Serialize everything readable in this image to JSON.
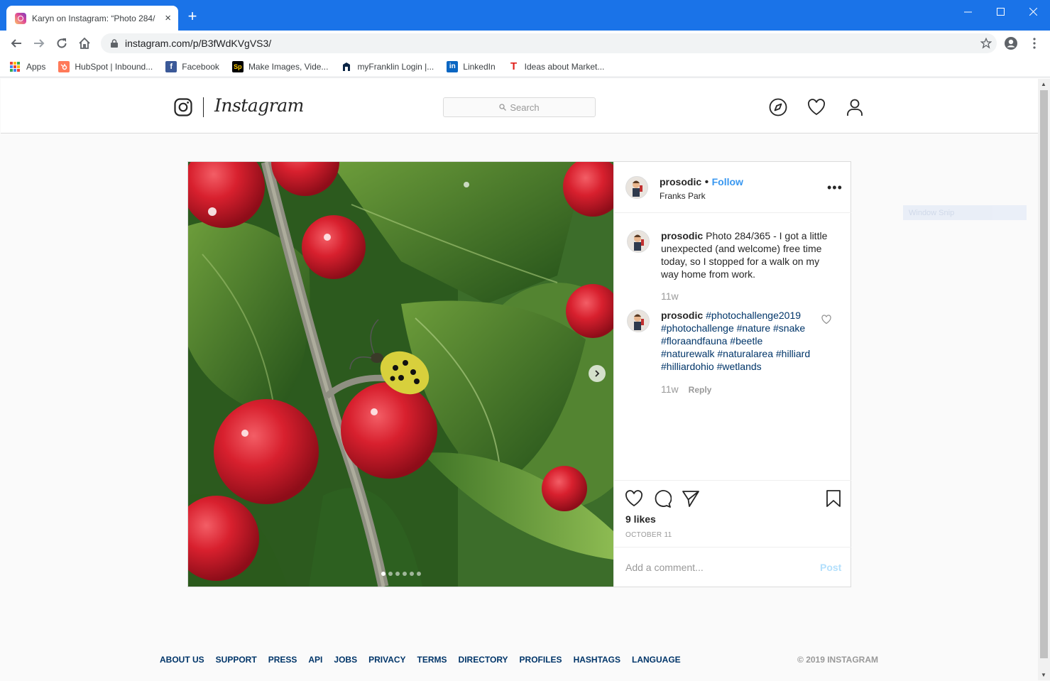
{
  "browser": {
    "tab_title": "Karyn on Instagram: “Photo 284/",
    "tab_close": "×",
    "new_tab": "+",
    "url": "instagram.com/p/B3fWdKVgVS3/",
    "bookmarks": [
      {
        "label": "Apps",
        "icon": "apps-grid-icon"
      },
      {
        "label": "HubSpot | Inbound...",
        "icon": "hubspot-icon",
        "color": "#ff7a59"
      },
      {
        "label": "Facebook",
        "icon": "facebook-icon",
        "color": "#3b5998",
        "glyph": "f"
      },
      {
        "label": "Make Images, Vide...",
        "icon": "spark-icon",
        "color": "#000000",
        "glyph": "Sp"
      },
      {
        "label": "myFranklin Login |...",
        "icon": "franklin-icon",
        "color": "#0b2545"
      },
      {
        "label": "LinkedIn",
        "icon": "linkedin-icon",
        "color": "#0a66c2",
        "glyph": "in"
      },
      {
        "label": "Ideas about Market...",
        "icon": "t-icon",
        "color": "#e0201b",
        "glyph": "T"
      }
    ]
  },
  "instagram": {
    "wordmark": "Instagram",
    "search_placeholder": "Search",
    "post": {
      "username": "prosodic",
      "separator": " • ",
      "follow": "Follow",
      "location": "Franks Park",
      "more": "•••",
      "caption_user": "prosodic",
      "caption": "Photo 284/365 - I got a little unexpected (and welcome) free time today, so I stopped for a walk on my way home from work.",
      "caption_age": "11w",
      "hashtag_comment": {
        "user": "prosodic",
        "tags": "#photochallenge2019 #photochallenge #nature #snake #floraandfauna #beetle #naturewalk #naturalarea #hilliard #hilliardohio #wetlands",
        "age": "11w",
        "reply": "Reply"
      },
      "likes": "9 likes",
      "date": "OCTOBER 11",
      "comment_placeholder": "Add a comment...",
      "post_button": "Post",
      "carousel_count": 6,
      "carousel_active": 1
    },
    "footer": {
      "links": [
        "ABOUT US",
        "SUPPORT",
        "PRESS",
        "API",
        "JOBS",
        "PRIVACY",
        "TERMS",
        "DIRECTORY",
        "PROFILES",
        "HASHTAGS",
        "LANGUAGE"
      ],
      "copyright": "© 2019 INSTAGRAM"
    }
  },
  "overlay": {
    "snip_label": "Window Snip"
  }
}
